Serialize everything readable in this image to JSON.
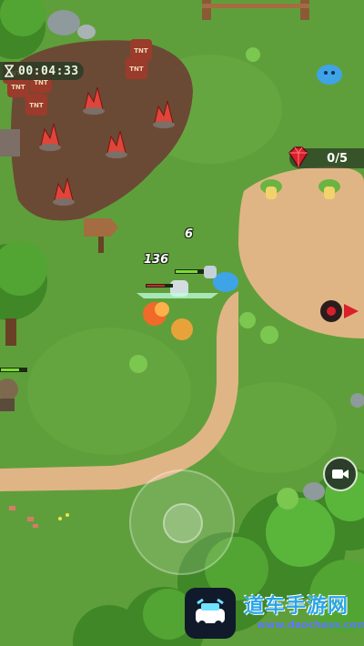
{
  "hud": {
    "timer": "00:04:33",
    "quest_progress": "0/5",
    "quest_gem_icon": "red-gem-icon",
    "hourglass_icon": "hourglass-icon"
  },
  "combat": {
    "damage_136": "136",
    "damage_6": "6"
  },
  "props": {
    "barrel_label": "TNT"
  },
  "controls": {
    "camera_icon": "video-camera-icon",
    "joystick": "virtual-joystick"
  },
  "watermark": {
    "logo_icon": "car-logo-icon",
    "text": "道车手游网",
    "url": "www.daochess.com"
  },
  "colors": {
    "grass": "#5f9f3b",
    "dirt": "#6b4a35",
    "sand": "#e0b585",
    "tree": "#4f9a2f",
    "hud_bg": "#283a26",
    "accent_red": "#d8202b"
  }
}
